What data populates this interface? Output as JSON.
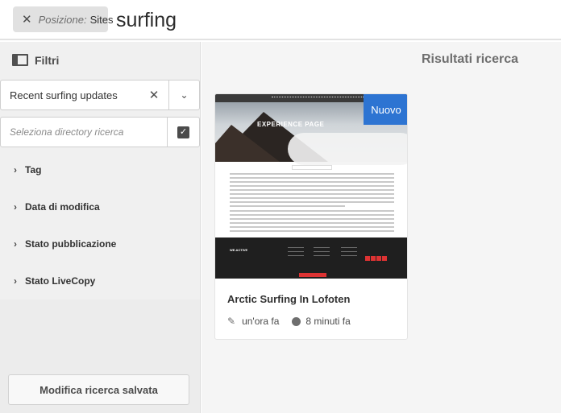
{
  "search": {
    "chip_label": "Posizione:",
    "chip_value": "Sites",
    "query": "surfing"
  },
  "filters": {
    "title": "Filtri",
    "saved_search": "Recent surfing updates",
    "directory_placeholder": "Seleziona directory ricerca",
    "facets": [
      {
        "label": "Tag"
      },
      {
        "label": "Data di modifica"
      },
      {
        "label": "Stato pubblicazione"
      },
      {
        "label": "Stato LiveCopy"
      }
    ],
    "edit_saved_button": "Modifica ricerca salvata"
  },
  "results": {
    "title": "Risultati ricerca",
    "cards": [
      {
        "badge": "Nuovo",
        "title": "Arctic Surfing In Lofoten",
        "modified": "un'ora fa",
        "published": "8 minuti fa",
        "thumb_hero_text": "EXPERIENCE PAGE",
        "thumb_logo": "WE.ACTIVE"
      }
    ]
  },
  "colors": {
    "accent": "#2d74d2",
    "panel_bg": "#f0f0f0",
    "pane_bg": "#f5f5f5"
  },
  "icons": [
    "close-icon",
    "rail-icon",
    "chevron-down-icon",
    "checkbox-icon",
    "chevron-right-icon",
    "pencil-icon",
    "globe-icon"
  ]
}
